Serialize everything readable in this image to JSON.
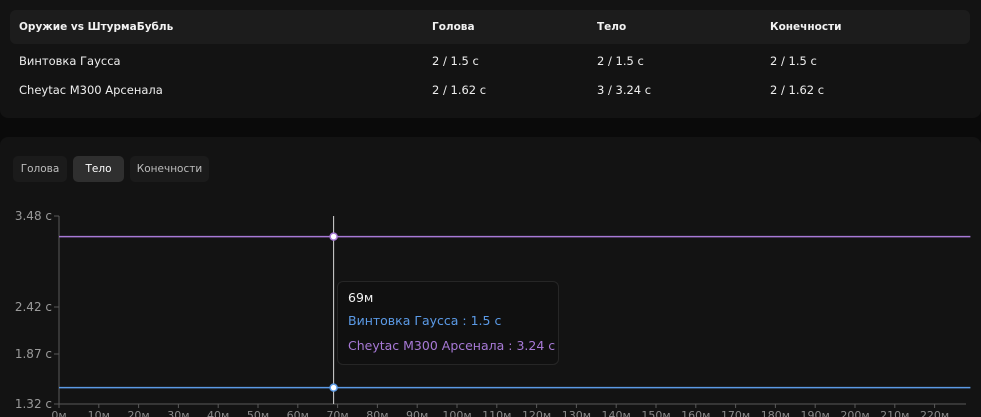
{
  "table": {
    "headers": [
      "Оружие vs ШтурмаБубль",
      "Голова",
      "Тело",
      "Конечности"
    ],
    "rows": [
      [
        "Винтовка Гаусса",
        "2 / 1.5 с",
        "2 / 1.5 с",
        "2 / 1.5 с"
      ],
      [
        "Cheytac M300 Арсенала",
        "2 / 1.62 с",
        "3 / 3.24 с",
        "2 / 1.62 с"
      ]
    ]
  },
  "tabs": {
    "items": [
      "Голова",
      "Тело",
      "Конечности"
    ],
    "active": "Тело"
  },
  "tooltip": {
    "title": "69м",
    "rows": [
      "Винтовка Гаусса : 1.5 с",
      "Cheytac M300 Арсенала : 3.24 с"
    ]
  },
  "colors": {
    "series_gauss": "#5b9ae6",
    "series_cheytac": "#a779d6",
    "cursor": "#d8d8d8"
  },
  "chart_data": {
    "type": "line",
    "x_unit": "м",
    "x_ticks": [
      "0м",
      "10м",
      "20м",
      "30м",
      "40м",
      "50м",
      "60м",
      "70м",
      "80м",
      "90м",
      "100м",
      "110м",
      "120м",
      "130м",
      "140м",
      "150м",
      "160м",
      "170м",
      "180м",
      "190м",
      "200м",
      "210м",
      "220м"
    ],
    "y_ticks": [
      "1.32 с",
      "1.87 с",
      "2.42 с",
      "3.48 с"
    ],
    "y_tick_values": [
      1.32,
      1.87,
      2.42,
      3.48
    ],
    "ylim": [
      1.32,
      3.48
    ],
    "xlim": [
      0,
      229
    ],
    "cursor_x": 69,
    "series": [
      {
        "name": "Винтовка Гаусса",
        "x": [
          0,
          229
        ],
        "y": [
          1.5,
          1.5
        ]
      },
      {
        "name": "Cheytac M300 Арсенала",
        "x": [
          0,
          229
        ],
        "y": [
          3.24,
          3.24
        ]
      }
    ]
  }
}
